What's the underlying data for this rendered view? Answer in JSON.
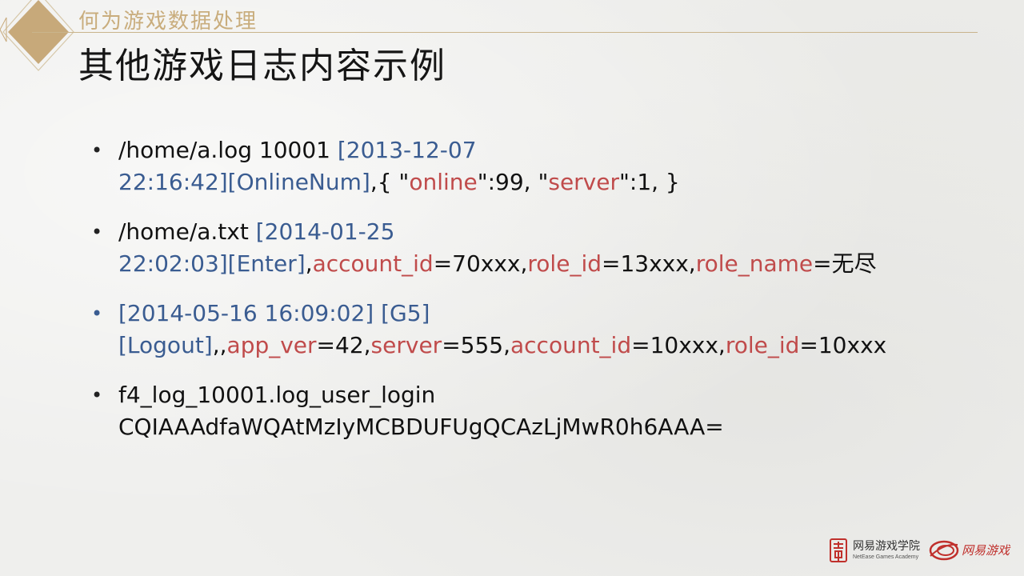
{
  "header": {
    "section_title": "何为游戏数据处理",
    "slide_title": "其他游戏日志内容示例"
  },
  "items": [
    {
      "bullet_color": "#222222",
      "line1": [
        {
          "t": "/home/a.log 10001 ",
          "c": "blk"
        },
        {
          "t": "[2013-12-07",
          "c": "blue"
        }
      ],
      "line2": [
        {
          "t": "22:16:42][OnlineNum]",
          "c": "blue"
        },
        {
          "t": ",{ \"",
          "c": "blk"
        },
        {
          "t": "online",
          "c": "red"
        },
        {
          "t": "\":99, \"",
          "c": "blk"
        },
        {
          "t": "server",
          "c": "red"
        },
        {
          "t": "\":1, }",
          "c": "blk"
        }
      ]
    },
    {
      "bullet_color": "#222222",
      "line1": [
        {
          "t": "/home/a.txt ",
          "c": "blk"
        },
        {
          "t": "[2014-01-25",
          "c": "blue"
        }
      ],
      "line2": [
        {
          "t": "22:02:03][Enter]",
          "c": "blue"
        },
        {
          "t": ",",
          "c": "blk"
        },
        {
          "t": "account_id",
          "c": "red"
        },
        {
          "t": "=70xxx,",
          "c": "blk"
        },
        {
          "t": "role_id",
          "c": "red"
        },
        {
          "t": "=13xxx,",
          "c": "blk"
        },
        {
          "t": "role_name",
          "c": "red"
        },
        {
          "t": "=无尽",
          "c": "blk"
        }
      ]
    },
    {
      "bullet_color": "#3a5c91",
      "line1": [
        {
          "t": "[2014-05-16 16:09:02] [G5]",
          "c": "blue"
        }
      ],
      "line2": [
        {
          "t": "[Logout]",
          "c": "blue"
        },
        {
          "t": ",,",
          "c": "blk"
        },
        {
          "t": "app_ver",
          "c": "red"
        },
        {
          "t": "=42,",
          "c": "blk"
        },
        {
          "t": "server",
          "c": "red"
        },
        {
          "t": "=555,",
          "c": "blk"
        },
        {
          "t": "account_id",
          "c": "red"
        },
        {
          "t": "=10xxx,",
          "c": "blk"
        },
        {
          "t": "role_id",
          "c": "red"
        },
        {
          "t": "=10xxx",
          "c": "blk"
        }
      ]
    },
    {
      "bullet_color": "#222222",
      "line1": [
        {
          "t": "f4_log_10001.log_user_login",
          "c": "blk"
        }
      ],
      "line2": [
        {
          "t": "CQIAAAdfaWQAtMzIyMCBDUFUgQCAzLjMwR0h6AAA=",
          "c": "blk"
        }
      ]
    }
  ],
  "footer": {
    "academy_cn": "网易游戏学院",
    "academy_en": "NetEase Games Academy",
    "games_cn": "网易游戏",
    "academy_icon": "academy-seal-icon",
    "games_icon": "netease-games-logo-icon"
  },
  "colors": {
    "accent_gold": "#c9ad7d",
    "key_red": "#c04b4b",
    "value_blue": "#3a5c91"
  }
}
